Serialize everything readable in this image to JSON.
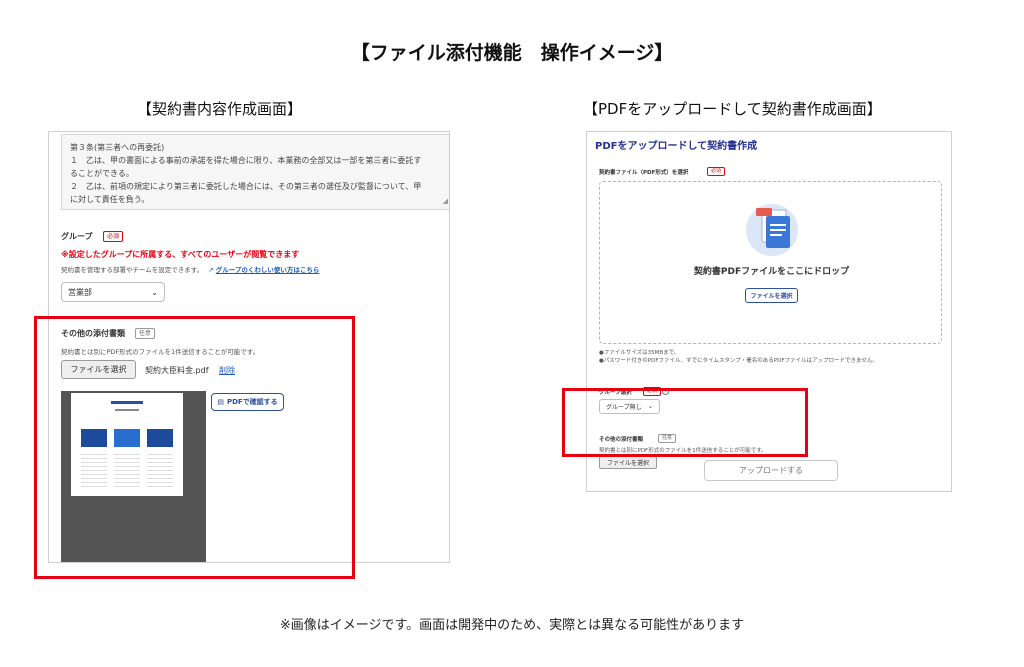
{
  "main_title": "【ファイル添付機能　操作イメージ】",
  "footer_note": "※画像はイメージです。画面は開発中のため、実際とは異なる可能性があります",
  "left_panel": {
    "heading": "【契約書内容作成画面】",
    "article_lines": [
      "第３条(第三者への再委託)",
      "１　乙は、甲の書面による事前の承諾を得た場合に限り、本業務の全部又は一部を第三者に委託す",
      "ることができる。",
      "２　乙は、前項の規定により第三者に委託した場合には、その第三者の選任及び監督について、甲",
      "に対して責任を負う。"
    ],
    "group_label": "グループ",
    "required_badge": "必須",
    "group_warning": "※設定したグループに所属する、すべてのユーザーが閲覧できます",
    "group_hint": "契約書を管理する部署やチームを設定できます。",
    "group_link": "グループのくわしい使い方はこちら",
    "group_value": "営業部",
    "attach_label": "その他の添付書類",
    "optional_badge": "任意",
    "attach_hint": "契約書とは別にPDF形式のファイルを1件送信することが可能です。",
    "file_button": "ファイルを選択",
    "file_name": "契約大臣料金.pdf",
    "delete_link": "削除",
    "confirm_button": "PDFで確認する"
  },
  "right_panel": {
    "heading": "【PDFをアップロードして契約書作成画面】",
    "title": "PDFをアップロードして契約書作成",
    "file_label": "契約書ファイル（PDF形式）を選択",
    "required_badge": "必須",
    "drop_text": "契約書PDFファイルをここにドロップ",
    "drop_button": "ファイルを選択",
    "note1": "●ファイルサイズは35MBまで。",
    "note2": "●パスワード付きのPDFファイル、すでにタイムスタンプ・署名のあるPDFファイルはアップロードできません。",
    "group_label": "グループ選択",
    "group_badge": "必須",
    "group_value": "グループ無し",
    "attach_label": "その他の添付書類",
    "optional_badge": "任意",
    "attach_hint": "契約書とは別にPDF形式のファイルを1件送信することが可能です。",
    "file_button": "ファイルを選択",
    "upload_button": "アップロードする"
  },
  "colors": {
    "highlight": "#e60012",
    "accent": "#24308f",
    "link": "#1a5bb8"
  }
}
